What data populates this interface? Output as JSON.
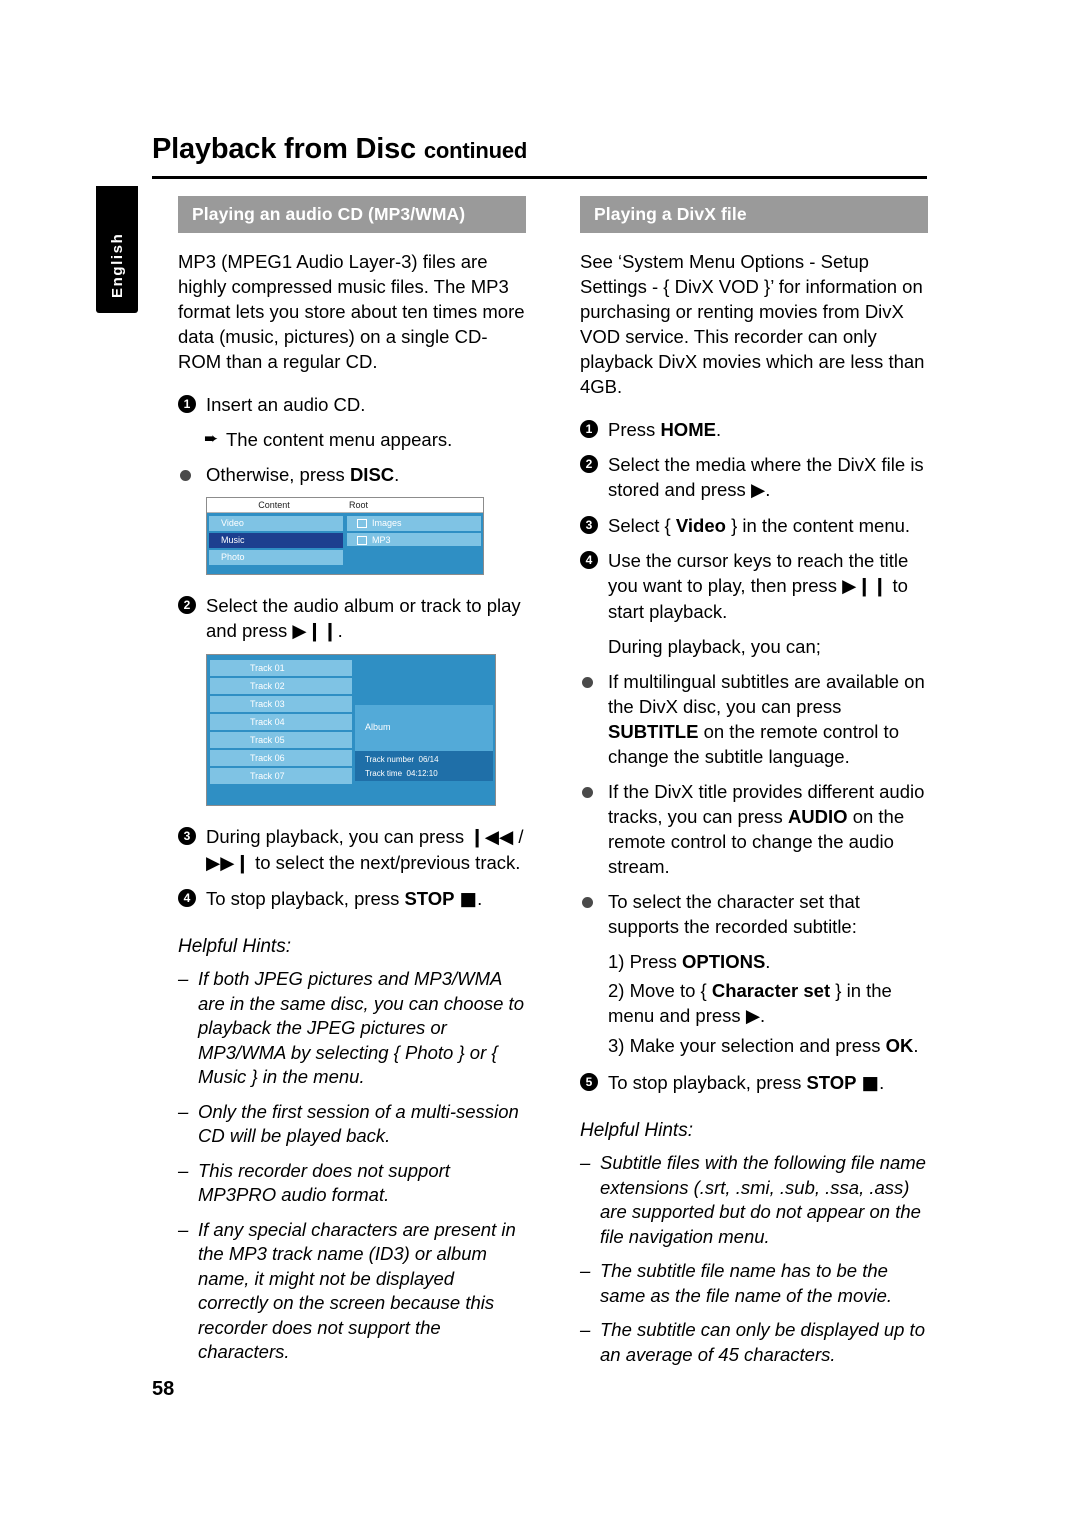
{
  "header": {
    "title": "Playback from Disc",
    "continued": "continued",
    "language_tab": "English"
  },
  "page_number": "58",
  "left_column": {
    "section_heading": "Playing an audio CD (MP3/WMA)",
    "intro": "MP3 (MPEG1 Audio Layer-3) files are highly compressed music files.  The MP3 format lets you store about ten times more data (music, pictures) on a single CD-ROM than a regular CD.",
    "step1": "Insert an audio CD.",
    "step1_sub": "The content menu appears.",
    "bullet1_pre": "Otherwise, press ",
    "bullet1_bold": "DISC",
    "bullet1_post": ".",
    "content_menu": {
      "col1_header": "Content",
      "col2_header": "Root",
      "left_items": [
        "Video",
        "Music",
        "Photo"
      ],
      "selected_left_item": "Music",
      "right_items": [
        "Images",
        "MP3"
      ]
    },
    "step2_a": "Select the audio album or track to play and press ",
    "step2_b": ".",
    "track_menu": {
      "tracks": [
        "Track 01",
        "Track 02",
        "Track 03",
        "Track 04",
        "Track 05",
        "Track 06",
        "Track 07"
      ],
      "album_label": "Album",
      "track_number_label": "Track number",
      "track_number_value": "06/14",
      "track_time_label": "Track time",
      "track_time_value": "04:12:10"
    },
    "step3_a": "During playback, you can press ",
    "step3_b": " / ",
    "step3_c": " to select the next/previous track.",
    "step4_a": "To stop playback, press ",
    "step4_bold": "STOP",
    "step4_b": ".",
    "hints_title": "Helpful Hints:",
    "hints": [
      "If both JPEG pictures and MP3/WMA are in the same disc, you can choose to playback the JPEG pictures or MP3/WMA by selecting { Photo } or { Music } in the menu.",
      "Only the first session of a multi-session CD will be played back.",
      "This recorder does not support MP3PRO audio format.",
      "If any special characters are present in the MP3 track name (ID3) or album name, it might not be displayed correctly on the screen because this recorder does not support the characters."
    ]
  },
  "right_column": {
    "section_heading": "Playing a DivX file",
    "intro": "See ‘System Menu Options - Setup Settings - { DivX VOD }’ for information on purchasing or renting movies from DivX VOD service. This recorder can only playback DivX movies which are less than 4GB.",
    "step1_pre": "Press ",
    "step1_bold": "HOME",
    "step1_post": ".",
    "step2_a": "Select the media where the DivX file is stored and press ",
    "step2_b": ".",
    "step3_a": "Select { ",
    "step3_bold": "Video",
    "step3_b": " } in the content menu.",
    "step4_a": "Use the cursor keys to reach the title you want to play, then press ",
    "step4_b": " to start playback.",
    "during": "During playback, you can;",
    "bullet1_a": "If multilingual subtitles are available on the DivX disc, you can press ",
    "bullet1_bold": "SUBTITLE",
    "bullet1_b": " on the remote control to change the subtitle language.",
    "bullet2_a": "If the DivX title provides different audio tracks, you can press ",
    "bullet2_bold": "AUDIO",
    "bullet2_b": " on the remote control to change the audio stream.",
    "bullet3": "To select the character set that supports the recorded subtitle:",
    "sub1_pre": "1)  Press ",
    "sub1_bold": "OPTIONS",
    "sub1_post": ".",
    "sub2_a": "2)  Move to { ",
    "sub2_bold": "Character set",
    "sub2_b": " } in the menu and press ",
    "sub2_c": ".",
    "sub3_a": "3)  Make your selection and press ",
    "sub3_bold": "OK",
    "sub3_b": ".",
    "step5_a": "To stop playback, press ",
    "step5_bold": "STOP",
    "step5_b": ".",
    "hints_title": "Helpful Hints:",
    "hints": [
      "Subtitle files with the following file name extensions (.srt, .smi, .sub, .ssa, .ass) are supported but do not appear on the file navigation menu.",
      "The subtitle file name has to be the same as the file name of the movie.",
      "The subtitle can only be displayed up to an average of 45 characters."
    ]
  },
  "icons": {
    "play_pause": "▶❙❙",
    "prev": "❙◀◀",
    "next": "▶▶❙",
    "stop": "■",
    "right_arrow": "▶",
    "sub_arrow": "➨"
  },
  "colors": {
    "heading_bar": "#9a9a9a",
    "screen_blue": "#2f8fc4",
    "screen_row": "#7fc3e4",
    "screen_select": "#1d3f8f"
  }
}
